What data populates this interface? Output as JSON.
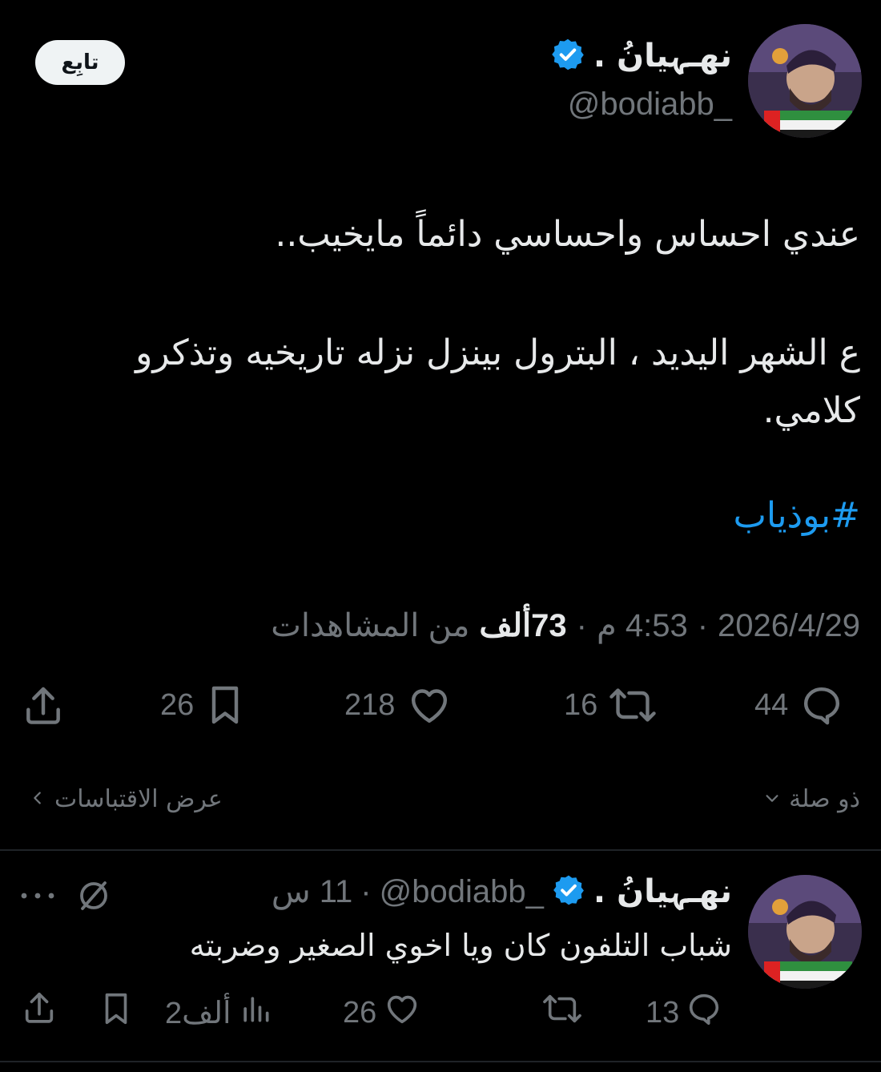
{
  "tweet": {
    "author_name": "نهـہيانُ .",
    "author_handle": "@bodiabb_",
    "follow_label": "تابِع",
    "lines": [
      "عندي احساس واحساسي دائماً مايخيب..",
      "ع الشهر اليديد ، البترول بينزل نزله تاريخيه وتذكرو",
      "كلامي."
    ],
    "hashtag": "#بوذياب",
    "date": "2026/4/29",
    "time": "4:53 م",
    "views_count": "73ألف",
    "views_label": "من المشاهدات",
    "sep": "·",
    "actions": {
      "replies": "44",
      "retweets": "16",
      "likes": "218",
      "bookmarks": "26"
    },
    "relevant_label": "ذو صلة",
    "quotes_label": "عرض الاقتباسات"
  },
  "reply": {
    "author_name": "نهـہيانُ .",
    "author_handle": "@bodiabb_",
    "time": "11 س",
    "text": "شباب التلفون كان ويا اخوي الصغير وضربته",
    "actions": {
      "replies": "13",
      "likes": "26",
      "views": "2ألف"
    }
  },
  "colors": {
    "background": "#000000",
    "text": "#e7e9ea",
    "muted": "#71767b",
    "accent": "#1d9bf0"
  },
  "icons": [
    "verified-badge-icon",
    "reply-icon",
    "retweet-icon",
    "like-icon",
    "bookmark-icon",
    "share-icon",
    "views-icon",
    "grok-icon",
    "more-icon",
    "chevron-down-icon",
    "chevron-left-icon"
  ]
}
